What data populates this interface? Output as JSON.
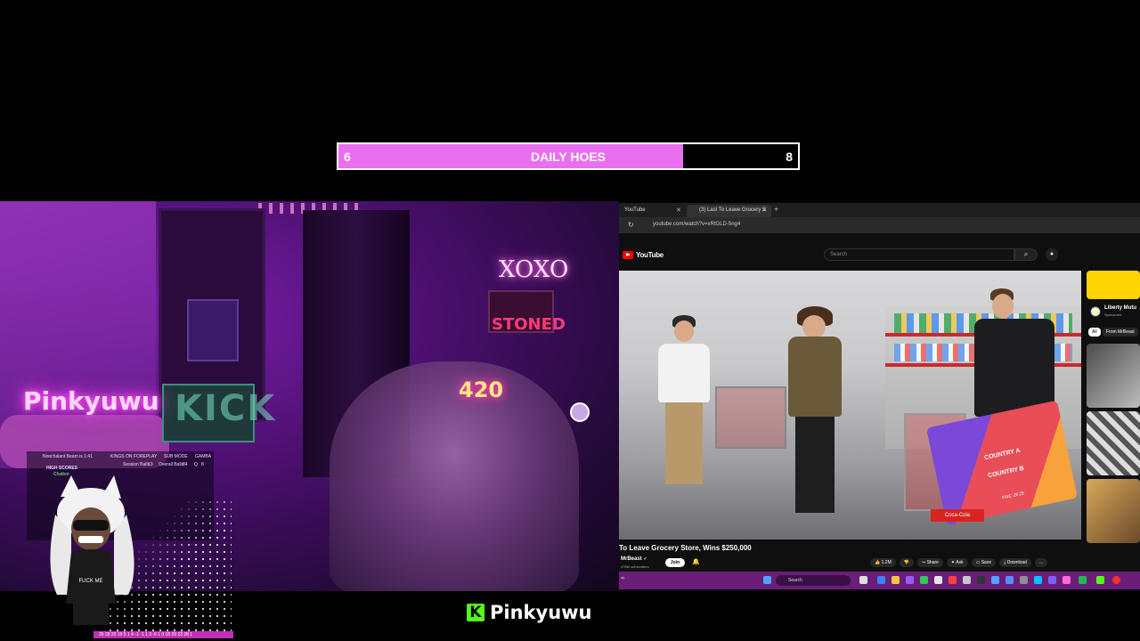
{
  "goal_bar": {
    "start": "6",
    "title": "DAILY HOES",
    "end": "8",
    "progress_fraction": 0.75,
    "fill_color": "#ea6ef0"
  },
  "webcam": {
    "neon_name": "Pinkyuwu",
    "neon_xoxo": "XOXO",
    "neon_stoned": "STONED",
    "neon_420": "420",
    "kick_wall": "KICK"
  },
  "scoreboard": {
    "timer": "Nonchalant Beam is 1:41",
    "high_scores": "HIGH SCORES",
    "status": "Chatbot",
    "col_kings": "KINGS ON",
    "col_foreplay": "FOREPLAY",
    "col_sub_mode": "SUB MODE",
    "col_gamba": "GAMBA",
    "row_session": "Session Balls",
    "row_session_val": "13",
    "row_overall": "Overall Balls",
    "row_overall_val": "84",
    "cell_q": "Q",
    "cell_8": "8"
  },
  "avatar_shirt": "FUCK ME",
  "bottom_strip": "26 28 20 19 5 1 4 -1 -1 1 3 -6 1 0 18 29 23 28 1",
  "browser": {
    "tab1": "YouTube",
    "tab2": "(3) Last To Leave Grocery S",
    "url": "youtube.com/watch?v=xRtGLD-5ng4",
    "yt_logo": "YouTube",
    "search_placeholder": "Search",
    "video_title": "To Leave Grocery Store, Wins $250,000",
    "channel": "MrBeast",
    "subs": "478M subscribers",
    "join": "Join",
    "actions": [
      "1.2M",
      "Share",
      "Ask",
      "Save",
      "Download",
      "..."
    ],
    "sign_a": "COUNTRY A",
    "sign_vs": "vs",
    "sign_b": "COUNTRY B",
    "sign_score": "FWC 28 25",
    "coke": "Coca-Cola",
    "sidebar": {
      "ad_name": "Liberty Mutu",
      "ad_sponsored": "Sponsored",
      "chip_all": "All",
      "chip_from": "From MrBeast"
    },
    "taskbar_search": "Search",
    "taskbar_tray": "ay"
  },
  "brand": {
    "name": "Pinkyuwu",
    "logo_letter": "K"
  }
}
